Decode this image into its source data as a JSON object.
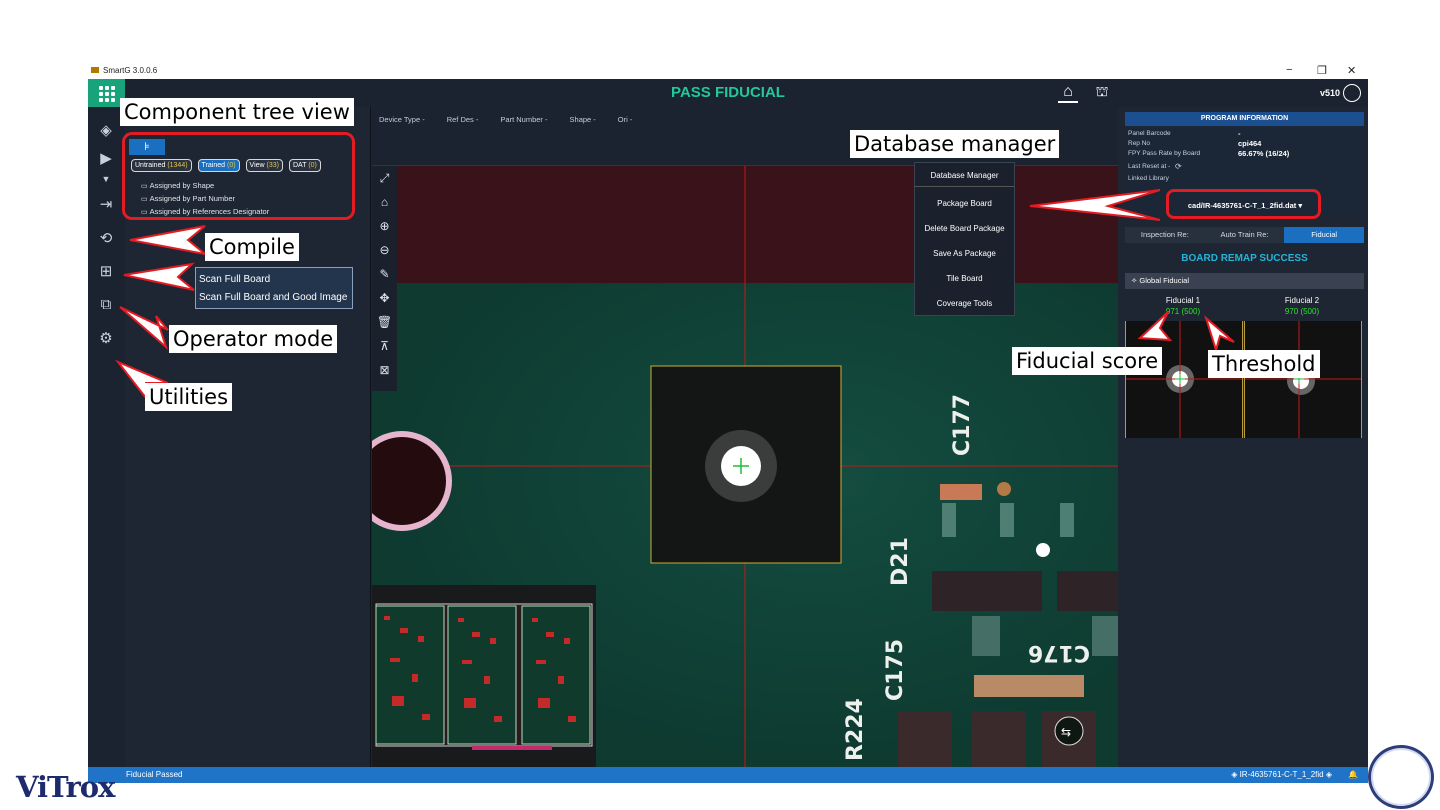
{
  "window": {
    "title": "SmartG 3.0.0.6",
    "minimize": "−",
    "maximize": "❐",
    "close": "✕"
  },
  "topbar": {
    "title": "PASS FIDUCIAL",
    "version": "v510"
  },
  "left_panel": {
    "filters": [
      {
        "label": "Untrained",
        "count": "(1344)"
      },
      {
        "label": "Trained",
        "count": "(0)"
      },
      {
        "label": "View",
        "count": "(33)"
      },
      {
        "label": "DAT",
        "count": "(0)"
      }
    ],
    "tree": [
      "Assigned by Shape",
      "Assigned by Part Number",
      "Assigned by References Designator"
    ]
  },
  "scan_menu": [
    "Scan Full Board",
    "Scan Full Board and Good Image"
  ],
  "columns": [
    "Device Type -",
    "Ref Des -",
    "Part Number -",
    "Shape -",
    "Ori -"
  ],
  "db_menu": [
    "Database Manager",
    "Package Board",
    "Delete Board Package",
    "Save As Package",
    "Tile Board",
    "Coverage Tools"
  ],
  "program_info": {
    "header": "PROGRAM INFORMATION",
    "panel_barcode_label": "Panel Barcode",
    "panel_barcode_value": "-",
    "rep_no_label": "Rep No",
    "rep_no_value": "cpi464",
    "fpy_label": "FPY Pass Rate by Board",
    "fpy_value": "66.67% (16/24)",
    "last_reset_label": "Last Reset at -",
    "linked_library_label": "Linked Library",
    "cad_file": "cad/IR-4635761-C-T_1_2fid.dat"
  },
  "tabs": [
    "Inspection Re:",
    "Auto Train Re:",
    "Fiducial"
  ],
  "remap_status": "BOARD REMAP SUCCESS",
  "global_fiducial": "Global Fiducial",
  "fiducials": [
    {
      "name": "Fiducial 1",
      "score": "971 (500)"
    },
    {
      "name": "Fiducial 2",
      "score": "970 (500)"
    }
  ],
  "board_labels": [
    "C177",
    "D21",
    "C176",
    "C175",
    "R224"
  ],
  "status": {
    "left": "Fiducial Passed",
    "right": "IR-4635761-C-T_1_2fid"
  },
  "callouts": {
    "component_tree": "Component tree view",
    "database_manager": "Database manager",
    "compile": "Compile",
    "operator_mode": "Operator mode",
    "utilities": "Utilities",
    "fiducial_score": "Fiducial score",
    "threshold": "Threshold"
  },
  "logo": "ViTrox",
  "colors": {
    "accent": "#21c89a",
    "status_bar": "#1f74c7",
    "annotation_red": "#e31b23",
    "score_green": "#2de02d"
  }
}
